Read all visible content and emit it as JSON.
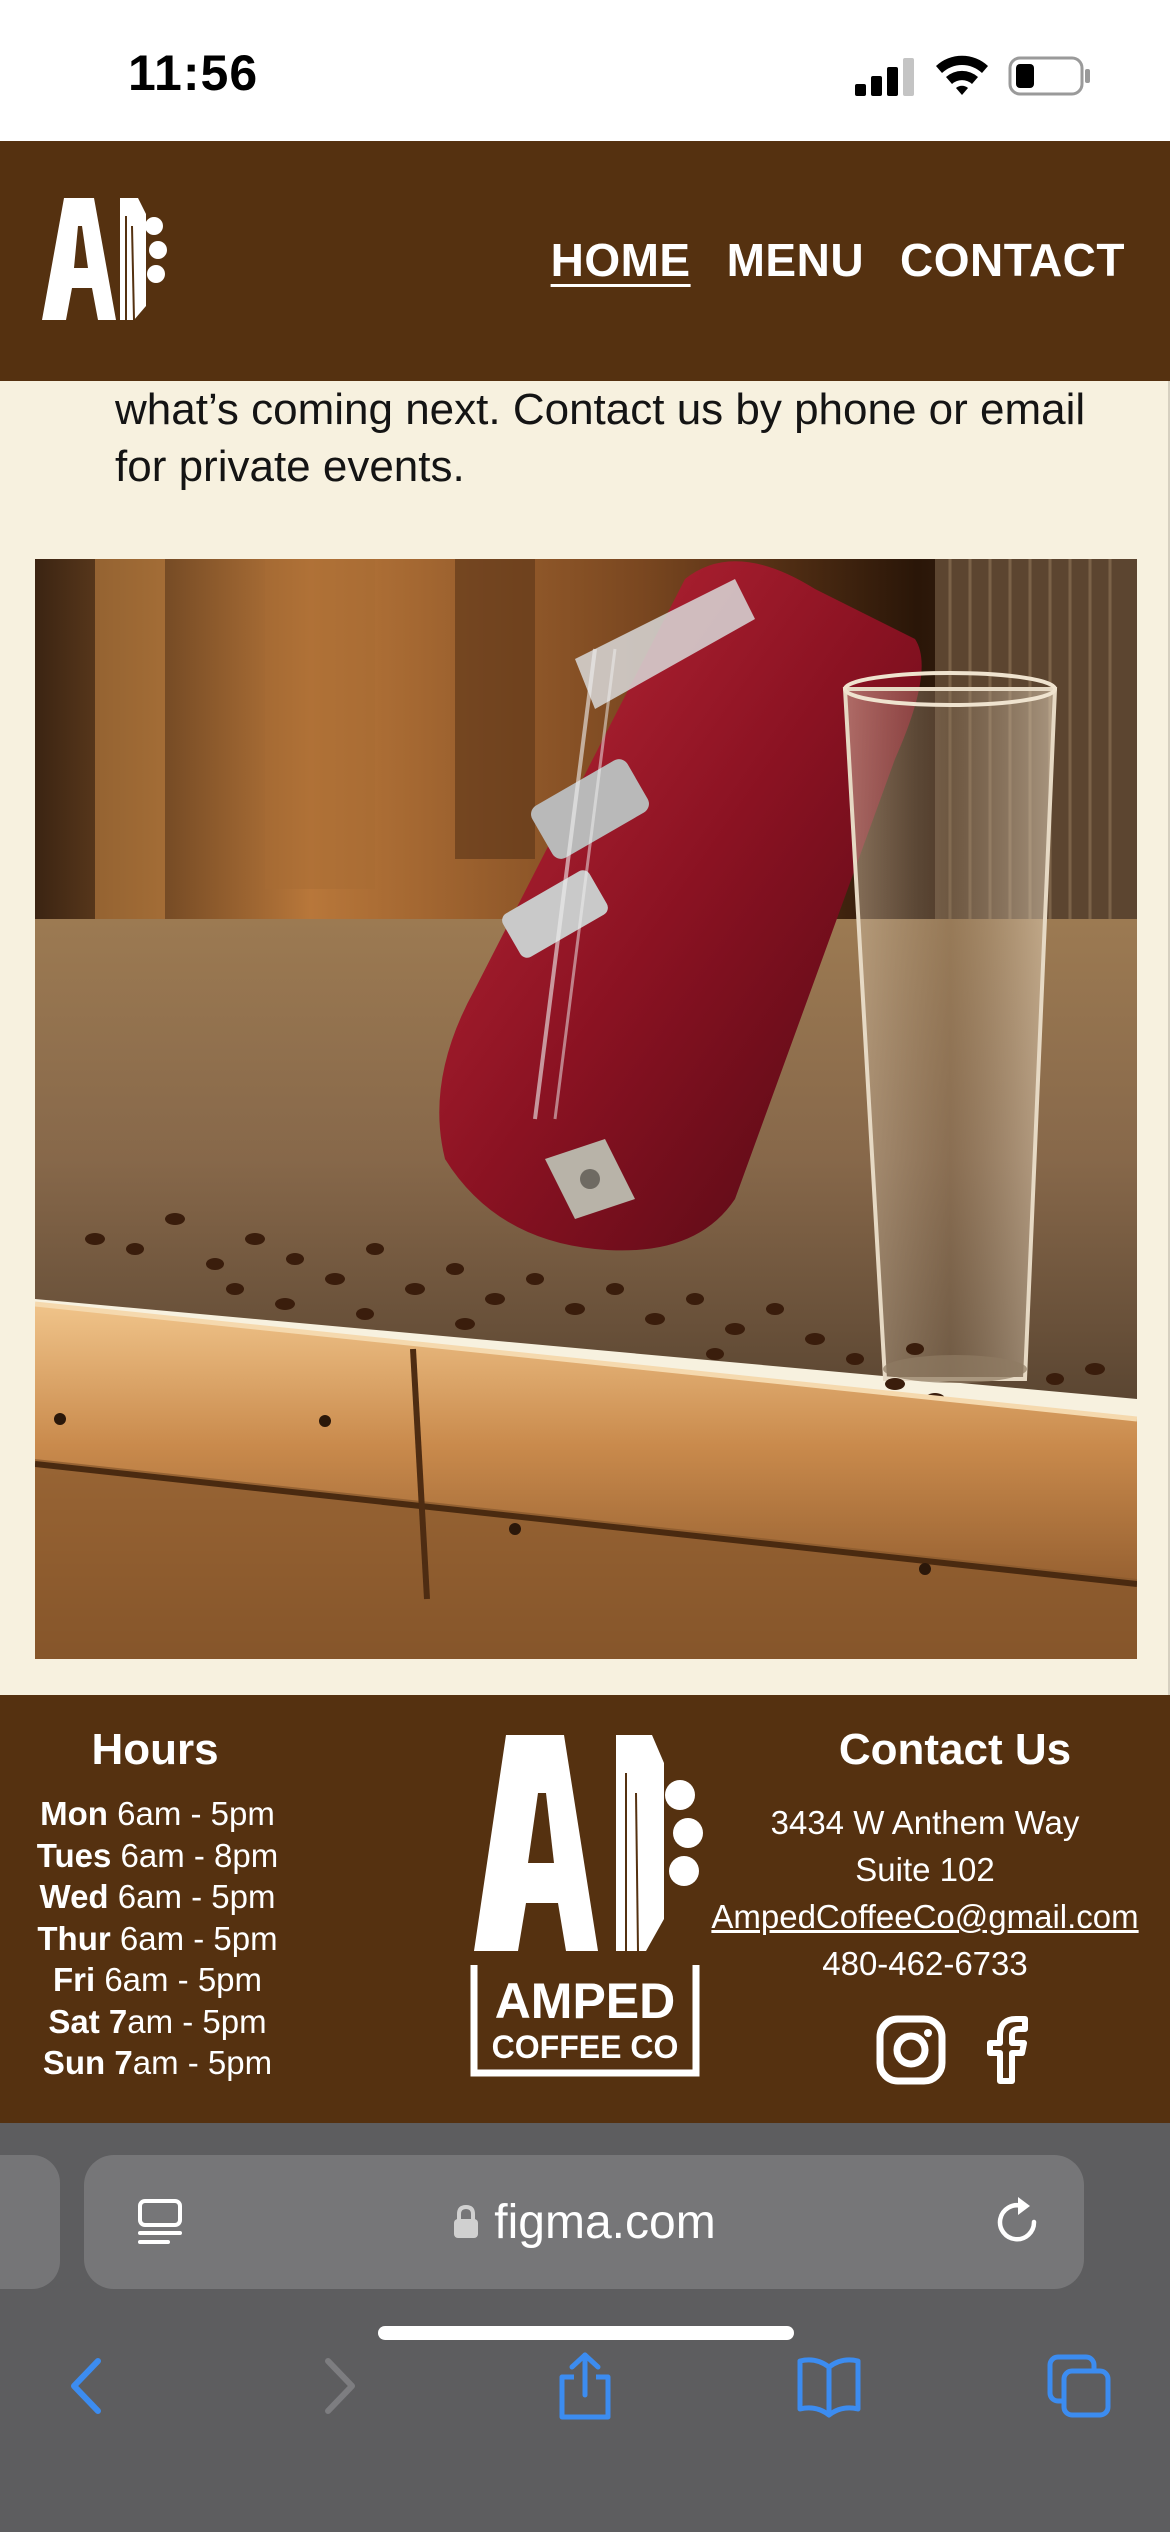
{
  "status_bar": {
    "time": "11:56",
    "icons": [
      "cellular-signal-icon",
      "wifi-icon",
      "battery-icon"
    ]
  },
  "header": {
    "logo_icon": "amped-guitar-headstock-logo-icon",
    "nav": [
      {
        "label": "HOME",
        "active": true
      },
      {
        "label": "MENU",
        "active": false
      },
      {
        "label": "CONTACT",
        "active": false
      }
    ],
    "background_color": "#553110"
  },
  "content": {
    "intro_text": "what’s coming next. Contact us by phone or email for private events.",
    "photo_subject": "red-electric-guitar-coffee-beans-glass-photo",
    "background_color": "#f7f1df"
  },
  "footer": {
    "hours_title": "Hours",
    "hours": [
      {
        "day": "Mon",
        "time": "6am - 5pm"
      },
      {
        "day": "Tues",
        "time": "6am - 8pm"
      },
      {
        "day": "Wed",
        "time": "6am - 5pm"
      },
      {
        "day": "Thur",
        "time": "6am - 5pm"
      },
      {
        "day": "Fri",
        "time": "6am - 5pm"
      },
      {
        "day": "Sat 7",
        "time": "am - 5pm"
      },
      {
        "day": "Sun 7",
        "time": "am - 5pm"
      }
    ],
    "logo_line1": "AMPED",
    "logo_line2": "COFFEE CO",
    "contact_title": "Contact Us",
    "address_line1": "3434 W Anthem Way",
    "address_line2": "Suite 102",
    "email": "AmpedCoffeeCo@gmail.com",
    "phone": "480-462-6733",
    "social_icons": [
      "instagram-icon",
      "facebook-icon"
    ]
  },
  "browser": {
    "url": "figma.com",
    "toolbar_icons": [
      "back-icon",
      "forward-icon",
      "share-icon",
      "bookmarks-icon",
      "tabs-icon"
    ],
    "accent_color": "#3c8cf0"
  }
}
